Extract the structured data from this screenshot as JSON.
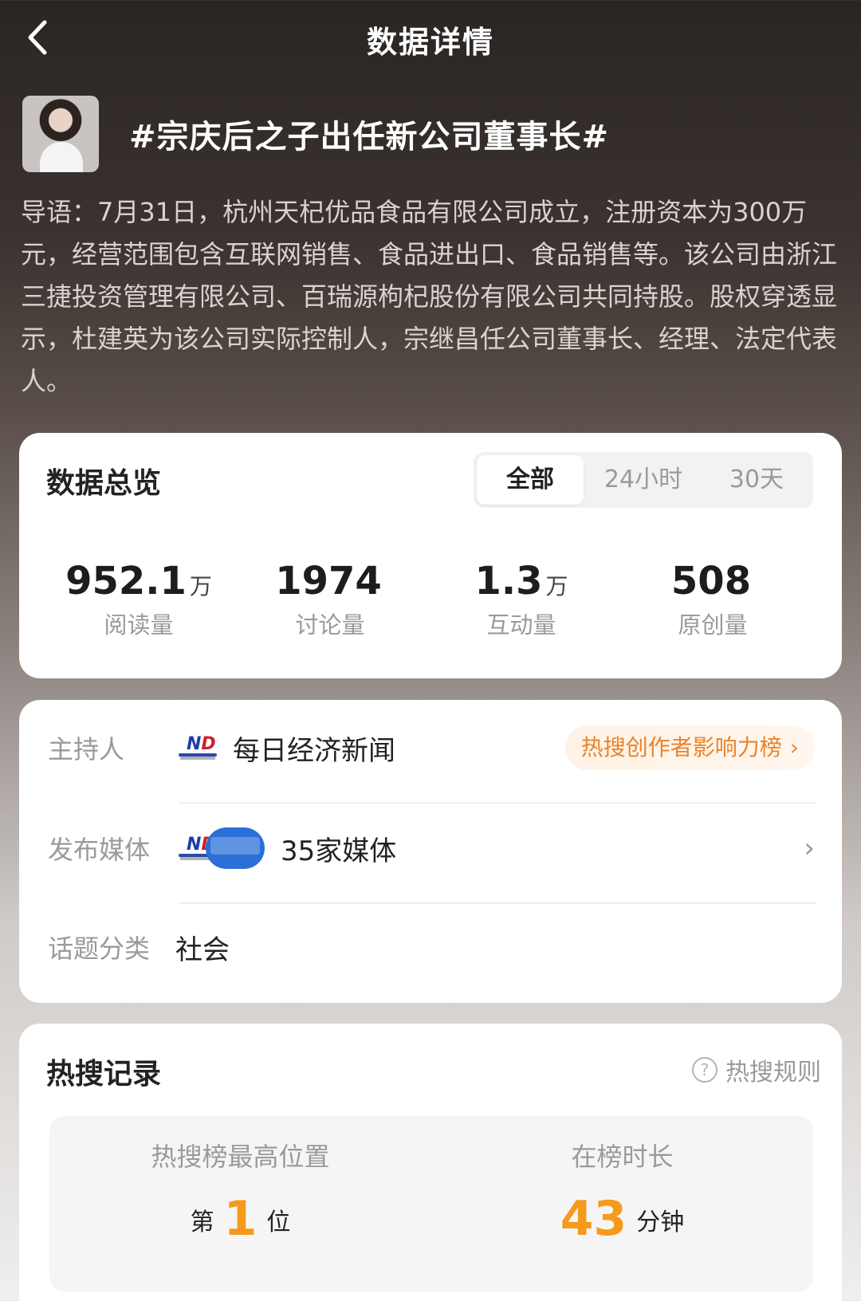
{
  "header": {
    "title": "数据详情"
  },
  "topic": {
    "title": "#宗庆后之子出任新公司董事长#",
    "intro": "导语：7月31日，杭州天杞优品食品有限公司成立，注册资本为300万元，经营范围包含互联网销售、食品进出口、食品销售等。该公司由浙江三捷投资管理有限公司、百瑞源枸杞股份有限公司共同持股。股权穿透显示，杜建英为该公司实际控制人，宗继昌任公司董事长、经理、法定代表人。"
  },
  "overview": {
    "title": "数据总览",
    "tabs": [
      {
        "label": "全部"
      },
      {
        "label": "24小时"
      },
      {
        "label": "30天"
      }
    ],
    "stats": [
      {
        "value": "952.1",
        "unit": "万",
        "label": "阅读量"
      },
      {
        "value": "1974",
        "unit": "",
        "label": "讨论量"
      },
      {
        "value": "1.3",
        "unit": "万",
        "label": "互动量"
      },
      {
        "value": "508",
        "unit": "",
        "label": "原创量"
      }
    ]
  },
  "info": {
    "host_label": "主持人",
    "host_name": "每日经济新闻",
    "rank_link": "热搜创作者影响力榜",
    "media_label": "发布媒体",
    "media_count": "35家媒体",
    "category_label": "话题分类",
    "category_value": "社会"
  },
  "record": {
    "title": "热搜记录",
    "rules_label": "热搜规则",
    "peak_label": "热搜榜最高位置",
    "peak_prefix": "第",
    "peak_value": "1",
    "peak_suffix": "位",
    "duration_label": "在榜时长",
    "duration_value": "43",
    "duration_unit": "分钟"
  },
  "colors": {
    "accent_orange": "#f59a1c",
    "rank_pill_text": "#e8842d"
  }
}
